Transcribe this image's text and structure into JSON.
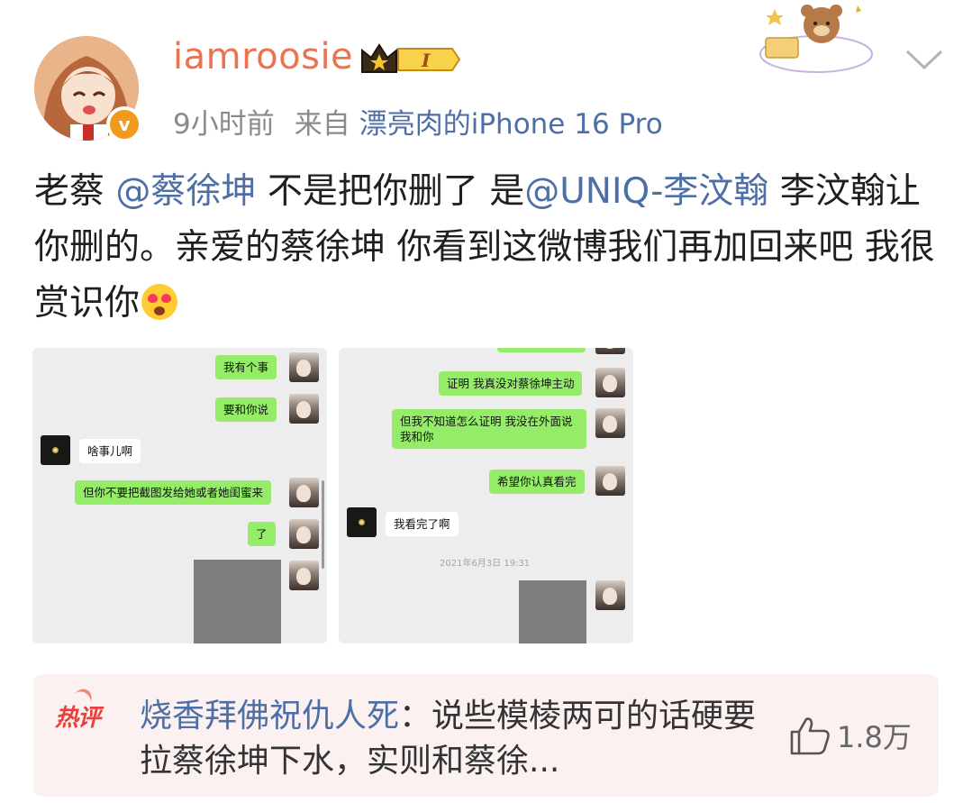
{
  "user": {
    "name": "iamroosie",
    "vip_level": "I",
    "verified_mark": "v"
  },
  "meta": {
    "time": "9小时前",
    "from_label": "来自",
    "device": "漂亮肉的iPhone 16 Pro"
  },
  "post": {
    "t1": "老蔡 ",
    "m1": "@蔡徐坤",
    "t2": " 不是把你删了 是",
    "m2": "@UNIQ-李汶翰",
    "t3": " 李汶翰让你删的。亲爱的蔡徐坤 你看到这微博我们再加回来吧 我很赏识你"
  },
  "shot1": {
    "b1": "我有个事",
    "b2": "要和你说",
    "b3": "啥事儿啊",
    "b4": "但你不要把截图发给她或者她闺蜜来",
    "b5": "了"
  },
  "shot2": {
    "b1": "证明 我真没对蔡徐坤主动",
    "b2": "但我不知道怎么证明 我没在外面说我和你",
    "b3": "希望你认真看完",
    "b4": "我看完了啊",
    "ts": "2021年6月3日 19:31"
  },
  "hot_comment": {
    "tag": "热评",
    "author": "烧香拜佛祝仇人死",
    "colon": "：",
    "text": "说些模棱两可的话硬要拉蔡徐坤下水，实则和蔡徐...",
    "likes": "1.8万"
  },
  "colors": {
    "username": "#eb7350",
    "link": "#4e6ea6",
    "wechat_green": "#95ec69",
    "hot_tag": "#e8403b",
    "verified": "#f29a1c"
  },
  "icons": [
    "verified-icon",
    "vip-crown-icon",
    "chevron-down-icon",
    "like-icon",
    "emoji-heart-eyes-icon"
  ]
}
